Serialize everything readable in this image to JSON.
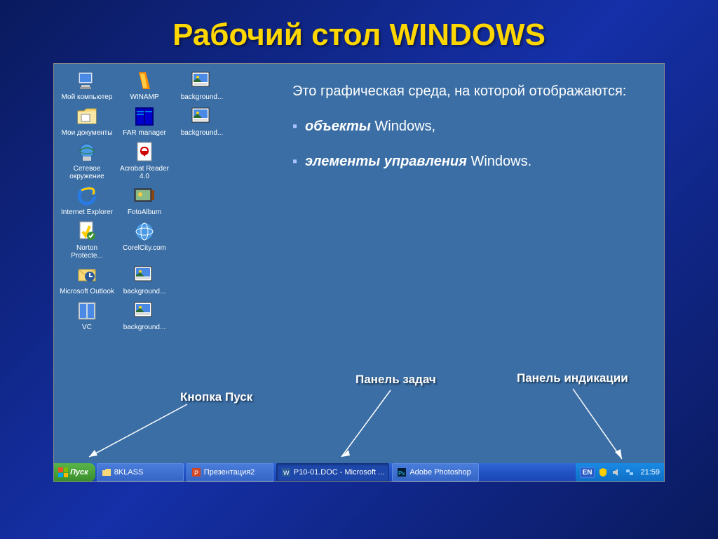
{
  "slide": {
    "title": "Рабочий стол WINDOWS",
    "description_intro": "Это графическая среда, на которой отображаются:",
    "bullets": [
      {
        "bold": "объекты",
        "rest": " Windows,"
      },
      {
        "bold": "элементы управления",
        "rest": " Windows."
      }
    ],
    "annotations": {
      "start_button": "Кнопка Пуск",
      "taskbar": "Панель задач",
      "tray": "Панель индикации"
    }
  },
  "desktop_icons": [
    [
      {
        "name": "my-computer",
        "label": "Мой компьютер",
        "icon": "computer"
      },
      {
        "name": "winamp",
        "label": "WINAMP",
        "icon": "winamp"
      },
      {
        "name": "background1",
        "label": "background...",
        "icon": "image"
      }
    ],
    [
      {
        "name": "my-documents",
        "label": "Мои документы",
        "icon": "folder"
      },
      {
        "name": "far-manager",
        "label": "FAR manager",
        "icon": "far"
      },
      {
        "name": "background2",
        "label": "background...",
        "icon": "image"
      }
    ],
    [
      {
        "name": "network",
        "label": "Сетевое окружение",
        "icon": "network"
      },
      {
        "name": "acrobat",
        "label": "Acrobat Reader 4.0",
        "icon": "pdf"
      },
      {
        "name": "empty1",
        "label": "",
        "icon": ""
      }
    ],
    [
      {
        "name": "ie",
        "label": "Internet Explorer",
        "icon": "ie"
      },
      {
        "name": "fotoalbum",
        "label": "FotoAlbum",
        "icon": "photo"
      },
      {
        "name": "empty2",
        "label": "",
        "icon": ""
      }
    ],
    [
      {
        "name": "norton",
        "label": "Norton Protecte...",
        "icon": "norton"
      },
      {
        "name": "corelcity",
        "label": "CorelCity.com",
        "icon": "corel"
      },
      {
        "name": "empty3",
        "label": "",
        "icon": ""
      }
    ],
    [
      {
        "name": "outlook",
        "label": "Microsoft Outlook",
        "icon": "outlook"
      },
      {
        "name": "background3",
        "label": "background...",
        "icon": "image"
      },
      {
        "name": "empty4",
        "label": "",
        "icon": ""
      }
    ],
    [
      {
        "name": "vc",
        "label": "VC",
        "icon": "vc"
      },
      {
        "name": "background4",
        "label": "background...",
        "icon": "image"
      },
      {
        "name": "empty5",
        "label": "",
        "icon": ""
      }
    ]
  ],
  "taskbar": {
    "start_label": "Пуск",
    "items": [
      {
        "name": "task-8klass",
        "label": "8KLASS",
        "icon": "folder-small"
      },
      {
        "name": "task-presentation",
        "label": "Презентация2",
        "icon": "ppt"
      },
      {
        "name": "task-word",
        "label": "P10-01.DOC - Microsoft ...",
        "icon": "word",
        "active": true
      },
      {
        "name": "task-photoshop",
        "label": "Adobe Photoshop",
        "icon": "ps"
      }
    ],
    "tray": {
      "lang": "EN",
      "clock": "21:59"
    }
  }
}
